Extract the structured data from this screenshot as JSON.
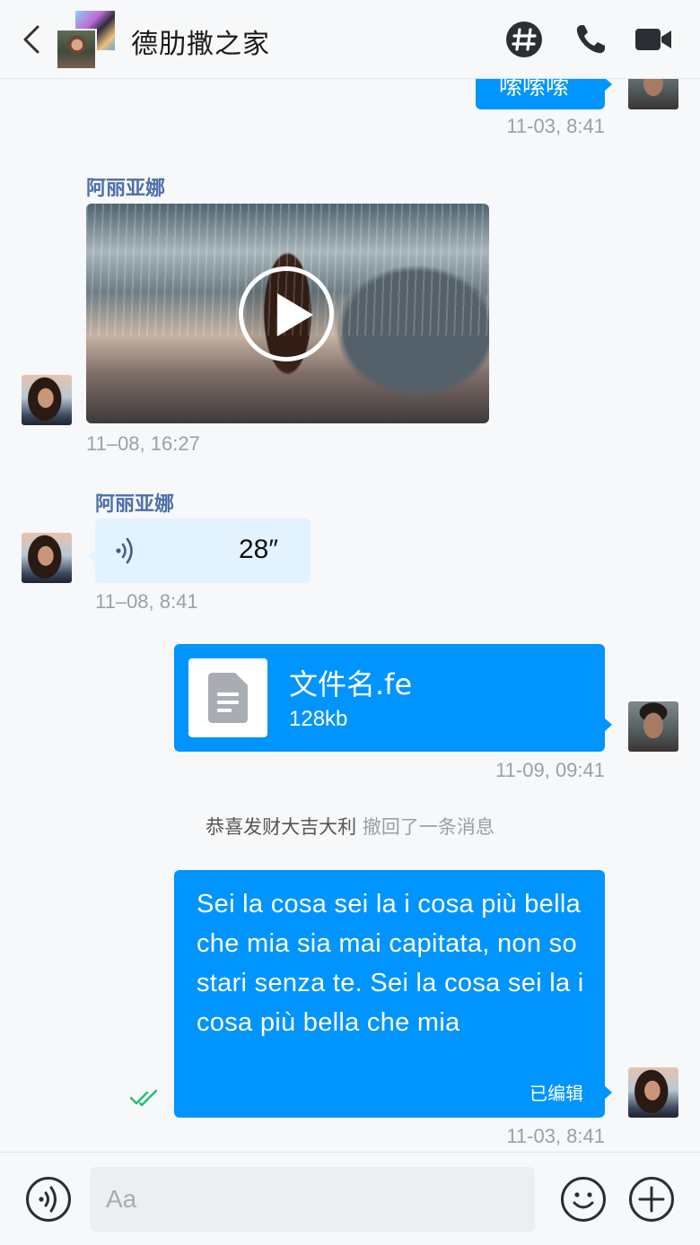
{
  "header": {
    "title": "德肋撒之家",
    "back_icon": "chevron-left-icon",
    "hashtag_icon": "hashtag-icon",
    "call_icon": "phone-icon",
    "video_icon": "video-camera-icon"
  },
  "messages": {
    "m0": {
      "text": "嗦嗦嗦",
      "timestamp": "11-03, 8:41"
    },
    "m1": {
      "sender": "阿丽亚娜",
      "type": "video",
      "timestamp": "11–08, 16:27"
    },
    "m2": {
      "sender": "阿丽亚娜",
      "type": "voice",
      "duration": "28″",
      "timestamp": "11–08, 8:41"
    },
    "m3": {
      "type": "file",
      "file_name": "文件名.fe",
      "file_size": "128kb",
      "timestamp": "11-09, 09:41"
    },
    "notice": {
      "user": "恭喜发财大吉大利",
      "action": "撤回了一条消息"
    },
    "m4": {
      "text": "Sei la cosa sei la i cosa più bella che mia sia mai capitata, non so stari senza te. Sei la cosa sei la i cosa più bella che mia",
      "edited_label": "已编辑",
      "timestamp": "11-03, 8:41",
      "read_status": "read"
    }
  },
  "composer": {
    "placeholder": "Aa",
    "voice_icon": "voice-icon",
    "emoji_icon": "emoji-icon",
    "add_icon": "plus-circle-icon"
  },
  "colors": {
    "accent": "#0094FF",
    "incoming_bubble": "#E3F2FF",
    "name": "#4C6FA8",
    "read_check": "#1FBF75"
  }
}
